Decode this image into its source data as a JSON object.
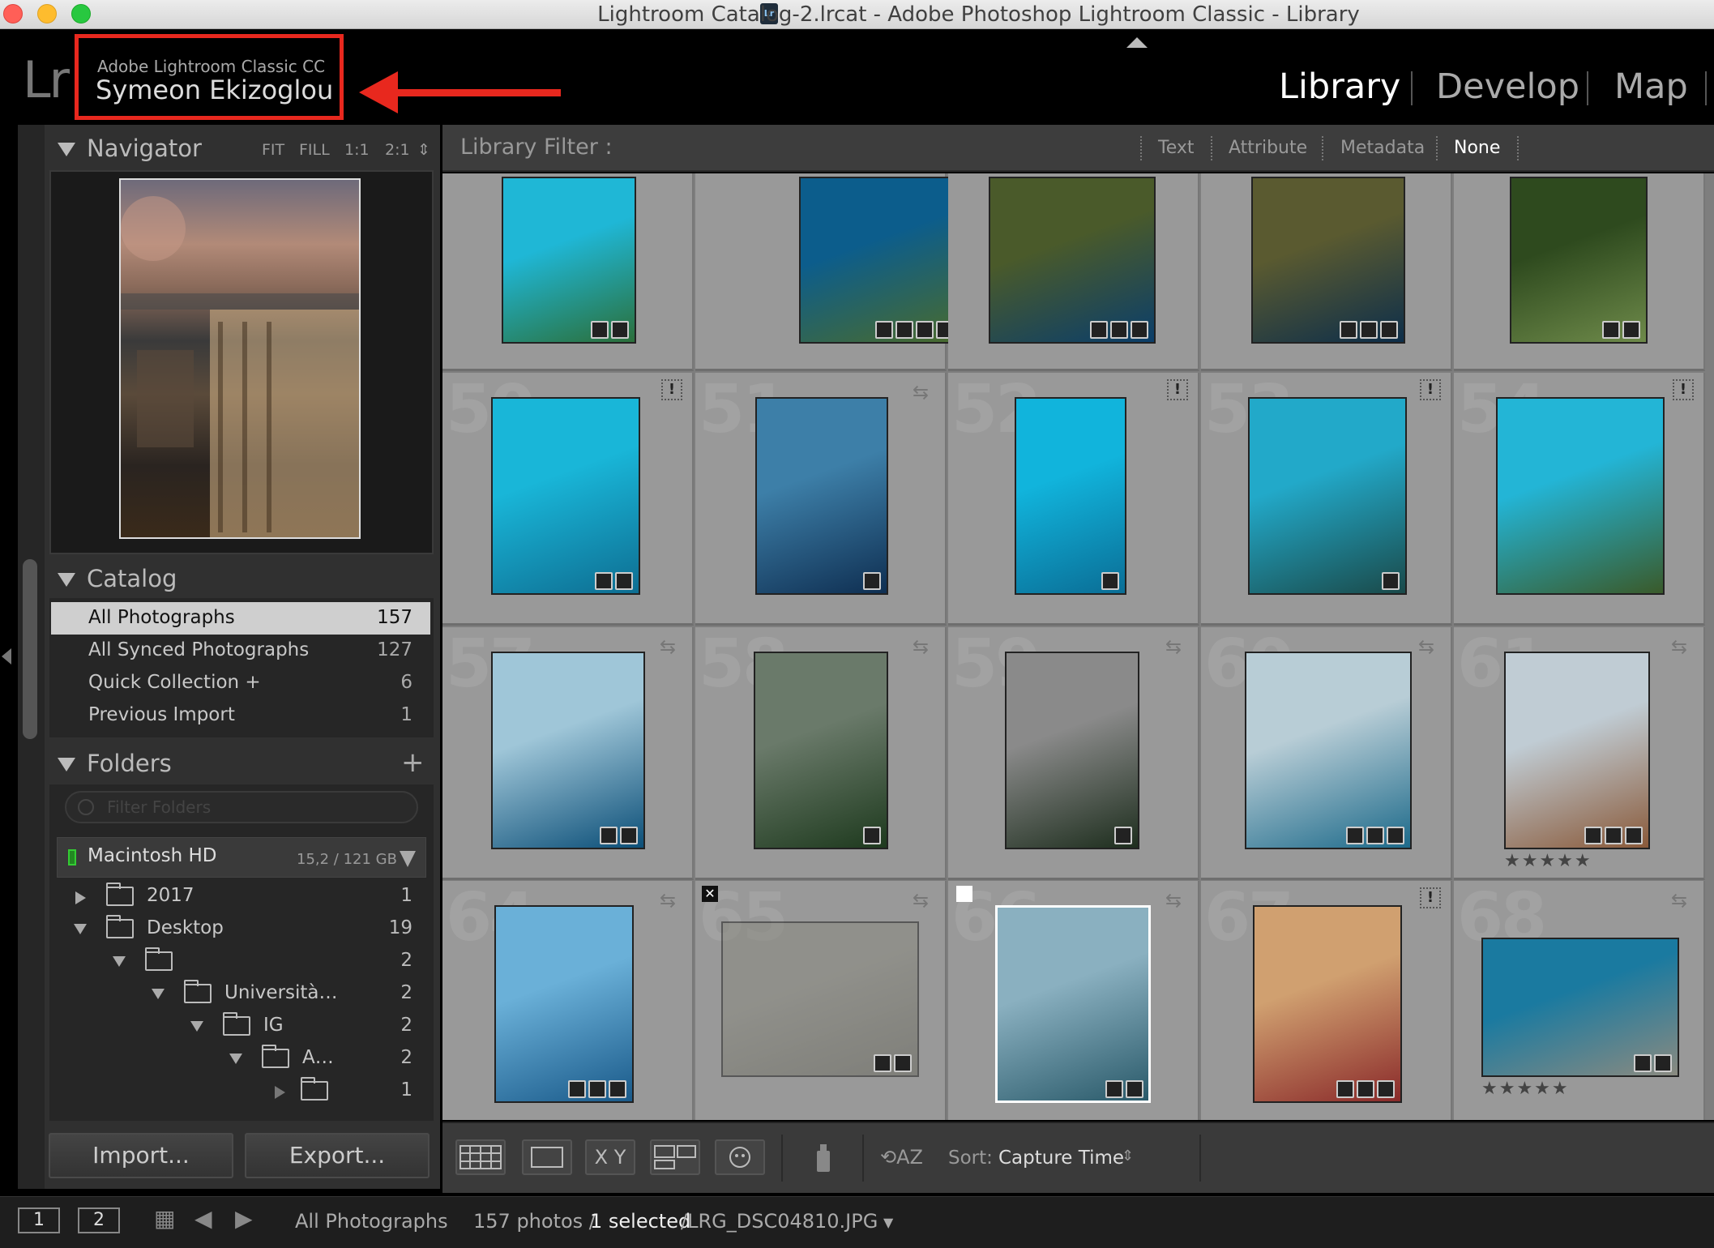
{
  "window": {
    "title": "Lightroom Catalog-2.lrcat - Adobe Photoshop Lightroom Classic - Library",
    "title_icon": "Lr"
  },
  "identity_plate": {
    "logo": "Lr",
    "product": "Adobe Lightroom Classic CC",
    "user": "Symeon Ekizoglou"
  },
  "modules": [
    "Library",
    "Develop",
    "Map"
  ],
  "active_module": "Library",
  "navigator": {
    "title": "Navigator",
    "options": [
      "FIT",
      "FILL",
      "1:1",
      "2:1"
    ]
  },
  "catalog": {
    "title": "Catalog",
    "items": [
      {
        "label": "All Photographs",
        "count": "157"
      },
      {
        "label": "All Synced Photographs",
        "count": "127"
      },
      {
        "label": "Quick Collection +",
        "count": "6"
      },
      {
        "label": "Previous Import",
        "count": "1"
      }
    ]
  },
  "folders": {
    "title": "Folders",
    "add_icon": "+",
    "filter_placeholder": "Filter Folders",
    "volume": {
      "name": "Macintosh HD",
      "size": "15,2 / 121 GB"
    },
    "tree": [
      {
        "label": "2017",
        "count": "1"
      },
      {
        "label": "Desktop",
        "count": "19"
      },
      {
        "label": "",
        "count": "2"
      },
      {
        "label": "Università…",
        "count": "2"
      },
      {
        "label": "IG",
        "count": "2"
      },
      {
        "label": "A…",
        "count": "2"
      },
      {
        "label": "",
        "count": "1"
      }
    ]
  },
  "buttons": {
    "import": "Import...",
    "export": "Export..."
  },
  "library_filter": {
    "label": "Library Filter :",
    "options": [
      "Text",
      "Attribute",
      "Metadata",
      "None"
    ],
    "active": "None"
  },
  "grid": {
    "rows": [
      [
        {
          "number": "",
          "rating": "",
          "flag": "",
          "badges": 2,
          "palette": [
            "#1fb7d6",
            "#2b6f3a"
          ]
        },
        {
          "number": "",
          "rating": "",
          "flag": "",
          "badges": 4,
          "palette": [
            "#0c5d8c",
            "#4a6b2c"
          ]
        },
        {
          "number": "",
          "rating": "",
          "flag": "",
          "badges": 3,
          "palette": [
            "#4a5a2a",
            "#0b3e6a"
          ]
        },
        {
          "number": "",
          "rating": "",
          "flag": "",
          "badges": 3,
          "palette": [
            "#5a5a30",
            "#0d2e4a"
          ]
        },
        {
          "number": "",
          "rating": "",
          "flag": "",
          "badges": 2,
          "palette": [
            "#2e4a1e",
            "#6e8a4a"
          ]
        }
      ],
      [
        {
          "number": "50",
          "rating": "",
          "flag": "",
          "badges": 2,
          "palette": [
            "#19b6d8",
            "#0e6e92"
          ]
        },
        {
          "number": "51",
          "rating": "",
          "flag": "",
          "badges": 1,
          "palette": [
            "#3d7fa8",
            "#0f2f52"
          ]
        },
        {
          "number": "52",
          "rating": "",
          "flag": "",
          "badges": 1,
          "palette": [
            "#11b4dc",
            "#0a6e96"
          ]
        },
        {
          "number": "53",
          "rating": "",
          "flag": "",
          "badges": 1,
          "palette": [
            "#22a9c9",
            "#1a4a4a"
          ]
        },
        {
          "number": "54",
          "rating": "",
          "flag": "",
          "badges": 0,
          "palette": [
            "#23b5d6",
            "#3a5a2a"
          ]
        }
      ],
      [
        {
          "number": "57",
          "rating": "",
          "flag": "",
          "badges": 2,
          "palette": [
            "#9fc6d8",
            "#0c4f78"
          ]
        },
        {
          "number": "58",
          "rating": "",
          "flag": "",
          "badges": 1,
          "palette": [
            "#6a7a6a",
            "#1e3a1e"
          ]
        },
        {
          "number": "59",
          "rating": "",
          "flag": "",
          "badges": 1,
          "palette": [
            "#8a8a8a",
            "#1e2e1e"
          ]
        },
        {
          "number": "60",
          "rating": "",
          "flag": "",
          "badges": 3,
          "palette": [
            "#b8cdd6",
            "#1d6a8a"
          ]
        },
        {
          "number": "61",
          "rating": "★★★★★",
          "flag": "",
          "badges": 3,
          "palette": [
            "#c0ccd4",
            "#8a5a3a"
          ]
        }
      ],
      [
        {
          "number": "64",
          "rating": "",
          "flag": "",
          "badges": 3,
          "palette": [
            "#6ab0d8",
            "#1a5a8a"
          ]
        },
        {
          "number": "65",
          "rating": "",
          "flag": "rejected",
          "badges": 2,
          "palette": [
            "#8a8a80",
            "#6a6a60"
          ]
        },
        {
          "number": "66",
          "rating": "",
          "flag": "pick",
          "badges": 2,
          "palette": [
            "#8ab0c0",
            "#2a5a6a"
          ]
        },
        {
          "number": "67",
          "rating": "",
          "flag": "",
          "badges": 3,
          "palette": [
            "#d0a070",
            "#8a2a2a"
          ]
        },
        {
          "number": "68",
          "rating": "★★★★★",
          "flag": "",
          "badges": 2,
          "palette": [
            "#1a7aa0",
            "#8a8a80"
          ]
        }
      ]
    ]
  },
  "toolbar": {
    "sort_label": "Sort:",
    "sort_value": "Capture Time"
  },
  "filmstrip": {
    "screen1": "1",
    "screen2": "2",
    "source": "All Photographs",
    "count_text": "157 photos /",
    "selected_text": "1 selected",
    "filename": "/LRG_DSC04810.JPG"
  },
  "colors": {
    "annotation_red": "#e8281e",
    "panel_bg": "#303030",
    "grid_bg": "#999999"
  }
}
